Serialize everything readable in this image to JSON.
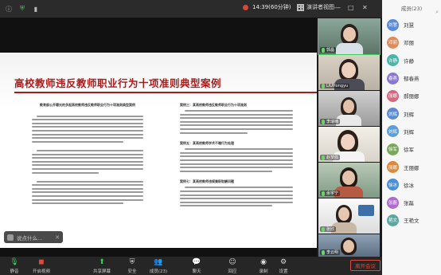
{
  "topbar": {
    "timer": "14:39(60分钟)",
    "view_label": "演讲者视图",
    "panel_title": "成员(23)"
  },
  "slide": {
    "title": "高校教师违反教师职业行为十项准则典型案例",
    "left_heading": "教育部公开曝光的多起高校教师违反教师职业行为十项准则典型案例",
    "right_headings": [
      "案例三：某高校教师违反教师职业行为十项准则",
      "案例五：某高校教师学术不端行为处理",
      "案例七：某高校教师违规兼职取酬问题"
    ]
  },
  "hint": {
    "text": "说点什么..."
  },
  "videos": [
    {
      "name": "郭晶"
    },
    {
      "name": "LIUHongyu"
    },
    {
      "name": "李瑞楠"
    },
    {
      "name": "赵梦鸽"
    },
    {
      "name": "余宇宁"
    },
    {
      "name": "张欣"
    },
    {
      "name": "李云明"
    }
  ],
  "participants": [
    {
      "name": "刘慧",
      "avatar": "刘慧",
      "color": "#5b8bd6"
    },
    {
      "name": "邓丽",
      "avatar": "邓丽",
      "color": "#e08a5a"
    },
    {
      "name": "许静",
      "avatar": "许静",
      "color": "#4fb3a8"
    },
    {
      "name": "郁春燕",
      "avatar": "春燕",
      "color": "#8a77d1"
    },
    {
      "name": "郝丽娜",
      "avatar": "丽娜",
      "color": "#d5677f"
    },
    {
      "name": "刘辉",
      "avatar": "刘辉",
      "color": "#5b8bd6"
    },
    {
      "name": "刘辉",
      "avatar": "刘辉",
      "color": "#5aa0d6"
    },
    {
      "name": "徐军",
      "avatar": "徐军",
      "color": "#7aa85a"
    },
    {
      "name": "王丽娜",
      "avatar": "丽娜",
      "color": "#d98a3c"
    },
    {
      "name": "徐冰",
      "avatar": "徐冰",
      "color": "#4a8fd6"
    },
    {
      "name": "张磊",
      "avatar": "张磊",
      "color": "#b06ad0"
    },
    {
      "name": "王艳文",
      "avatar": "艳文",
      "color": "#5aa8a0"
    }
  ],
  "toolbar": {
    "mute": "静音",
    "video": "开启视频",
    "share": "共享屏幕",
    "security": "安全",
    "members": "成员(23)",
    "chat": "聊天",
    "react": "回应",
    "record": "录制",
    "settings": "设置",
    "leave": "离开会议"
  }
}
